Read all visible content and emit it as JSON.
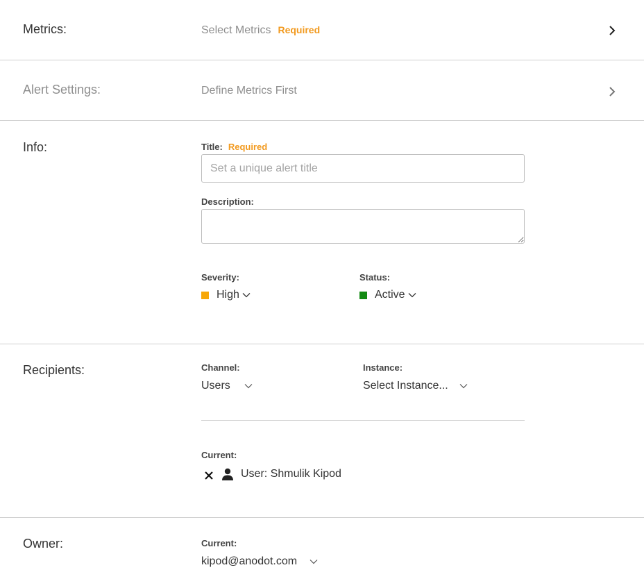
{
  "metrics": {
    "label": "Metrics:",
    "summary": "Select Metrics",
    "required": "Required"
  },
  "alert_settings": {
    "label": "Alert Settings:",
    "summary": "Define Metrics First"
  },
  "info": {
    "label": "Info:",
    "title_label": "Title:",
    "title_required": "Required",
    "title_placeholder": "Set a unique alert title",
    "title_value": "",
    "description_label": "Description:",
    "description_value": "",
    "severity_label": "Severity:",
    "severity_value": "High",
    "severity_color": "#f7a707",
    "status_label": "Status:",
    "status_value": "Active",
    "status_color": "#128a12"
  },
  "recipients": {
    "label": "Recipients:",
    "channel_label": "Channel:",
    "channel_value": "Users",
    "instance_label": "Instance:",
    "instance_value": "Select Instance...",
    "current_label": "Current:",
    "current_items": [
      {
        "text": "User: Shmulik Kipod",
        "icon": "user-icon"
      }
    ]
  },
  "owner": {
    "label": "Owner:",
    "current_label": "Current:",
    "current_value": "kipod@anodot.com"
  }
}
